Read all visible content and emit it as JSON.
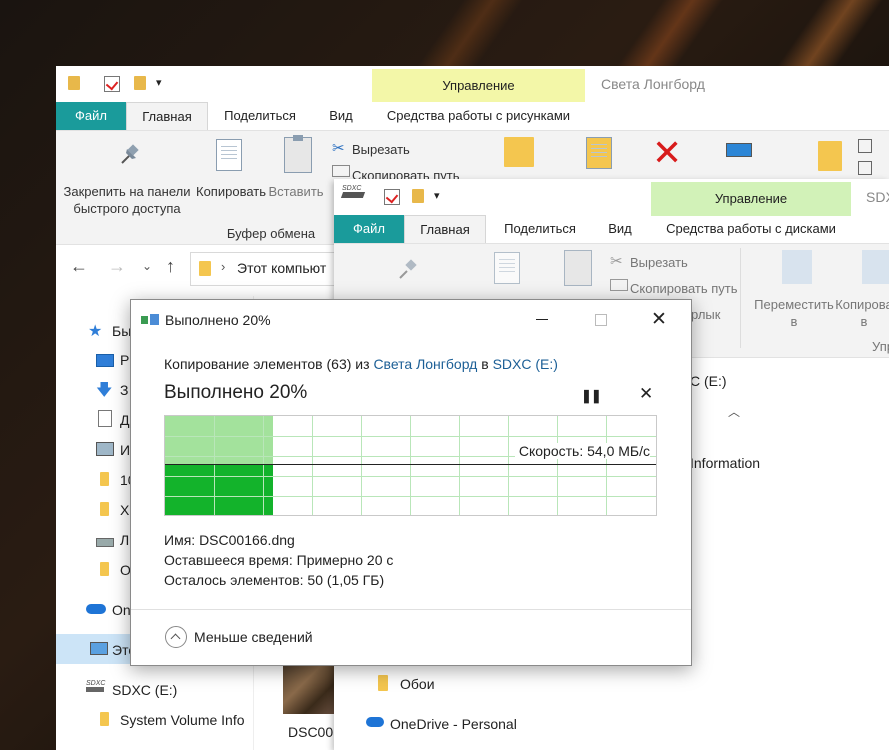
{
  "colors": {
    "file_tab": "#1a9b9b",
    "context_tab": "#f3f7a8",
    "progress_light": "#a3e29c",
    "progress_dark": "#13b32b",
    "link": "#1c5f96"
  },
  "back_window": {
    "context_header": "Управление",
    "window_title": "Света Лонгборд",
    "tabs": {
      "file": "Файл",
      "home": "Главная",
      "share": "Поделиться",
      "view": "Вид",
      "context": "Средства работы с рисунками"
    },
    "ribbon": {
      "pin_label": "Закрепить на панели быстрого доступа",
      "copy_label": "Копировать",
      "paste_label": "Вставить",
      "cut_label": "Вырезать",
      "copy_path_label": "Скопировать путь",
      "clipboard_group": "Буфер обмена"
    },
    "address": {
      "path": "Этот компьют"
    },
    "nav_items": [
      {
        "icon": "star-icon",
        "label": "Бы"
      },
      {
        "icon": "desktop-icon",
        "label": "Р"
      },
      {
        "icon": "download-icon",
        "label": "З"
      },
      {
        "icon": "document-icon",
        "label": "Д"
      },
      {
        "icon": "image-icon",
        "label": "И"
      },
      {
        "icon": "folder-icon",
        "label": "10"
      },
      {
        "icon": "folder-icon",
        "label": "Х"
      },
      {
        "icon": "drive-icon",
        "label": "Л"
      },
      {
        "icon": "folder-icon",
        "label": "О"
      },
      {
        "icon": "onedrive-icon",
        "label": "On"
      },
      {
        "icon": "computer-icon",
        "label": "Это"
      },
      {
        "icon": "sdxc-icon",
        "label": "SDXC (E:)"
      },
      {
        "icon": "folder-icon",
        "label": "System Volume Info"
      }
    ],
    "file_thumb_label": "DSC00"
  },
  "middle_window": {
    "context_header": "Управление",
    "window_title": "SDX",
    "tabs": {
      "file": "Файл",
      "home": "Главная",
      "share": "Поделиться",
      "view": "Вид",
      "context": "Средства работы с дисками"
    },
    "ribbon": {
      "cut_label": "Вырезать",
      "copy_path_label": "Скопировать путь",
      "shortcut_label": "ярлык",
      "move_label": "Переместить в",
      "copy_to_label": "Копирова в",
      "group_label": "Упр"
    },
    "address": {
      "path": "C (E:)"
    },
    "content": {
      "info_text": "Information",
      "wallpapers": "Обои",
      "onedrive": "OneDrive - Personal"
    }
  },
  "dialog": {
    "title": "Выполнено 20%",
    "copy_prefix": "Копирование элементов (63) из",
    "source": "Света Лонгборд",
    "in_word": "в",
    "destination": "SDXC (E:)",
    "heading": "Выполнено 20%",
    "speed": "Скорость: 54,0 МБ/с",
    "progress": 0.22,
    "name_label": "Имя:",
    "name_value": "DSC00166.dng",
    "time_label": "Оставшееся время:",
    "time_value": "Примерно 20 с",
    "items_label": "Осталось элементов:",
    "items_value": "50 (1,05 ГБ)",
    "less_details": "Меньше сведений"
  }
}
